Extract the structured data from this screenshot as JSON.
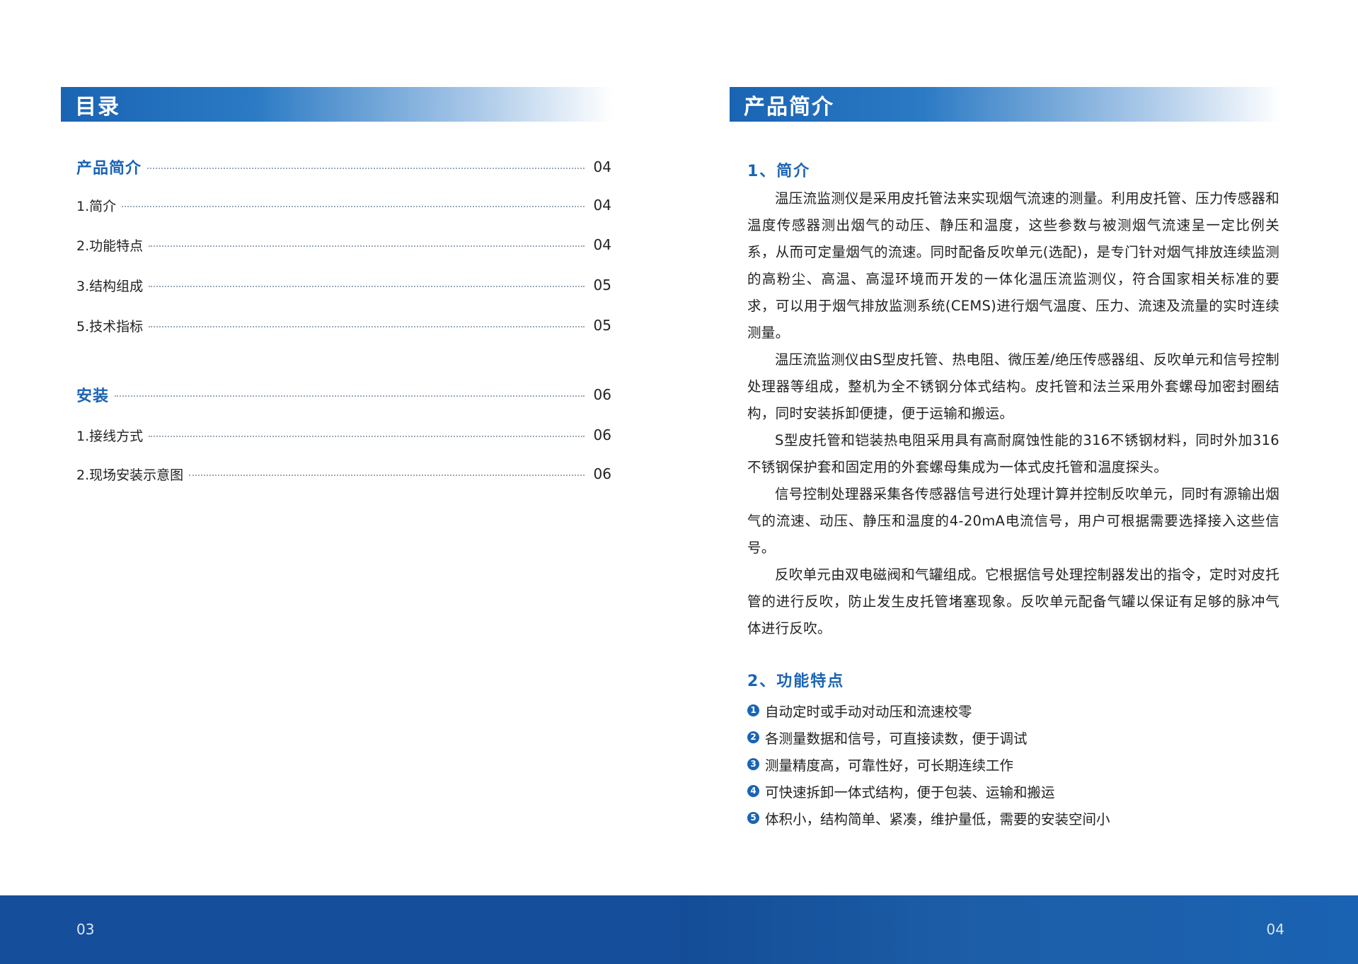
{
  "left": {
    "banner_title": "目录",
    "toc": [
      {
        "label": "产品简介",
        "page": "04",
        "section": true
      },
      {
        "label": "1.简介",
        "page": "04",
        "section": false
      },
      {
        "label": "2.功能特点",
        "page": "04",
        "section": false
      },
      {
        "label": "3.结构组成",
        "page": "05",
        "section": false
      },
      {
        "label": "5.技术指标",
        "page": "05",
        "section": false
      },
      {
        "label": "安装",
        "page": "06",
        "section": true
      },
      {
        "label": "1.接线方式",
        "page": "06",
        "section": false
      },
      {
        "label": "2.现场安装示意图",
        "page": "06",
        "section": false
      }
    ],
    "footer_page": "03"
  },
  "right": {
    "banner_title": "产品简介",
    "intro_heading": "1、简介",
    "paragraphs": [
      "温压流监测仪是采用皮托管法来实现烟气流速的测量。利用皮托管、压力传感器和温度传感器测出烟气的动压、静压和温度，这些参数与被测烟气流速呈一定比例关系，从而可定量烟气的流速。同时配备反吹单元(选配)，是专门针对烟气排放连续监测的高粉尘、高温、高湿环境而开发的一体化温压流监测仪，符合国家相关标准的要求，可以用于烟气排放监测系统(CEMS)进行烟气温度、压力、流速及流量的实时连续测量。",
      "温压流监测仪由S型皮托管、热电阻、微压差/绝压传感器组、反吹单元和信号控制处理器等组成，整机为全不锈钢分体式结构。皮托管和法兰采用外套螺母加密封圈结构，同时安装拆卸便捷，便于运输和搬运。",
      "S型皮托管和铠装热电阻采用具有高耐腐蚀性能的316不锈钢材料，同时外加316不锈钢保护套和固定用的外套螺母集成为一体式皮托管和温度探头。",
      "信号控制处理器采集各传感器信号进行处理计算并控制反吹单元，同时有源输出烟气的流速、动压、静压和温度的4-20mA电流信号，用户可根据需要选择接入这些信号。",
      "反吹单元由双电磁阀和气罐组成。它根据信号处理控制器发出的指令，定时对皮托管的进行反吹，防止发生皮托管堵塞现象。反吹单元配备气罐以保证有足够的脉冲气体进行反吹。"
    ],
    "features_heading": "2、功能特点",
    "features": [
      {
        "num": "1",
        "text": "自动定时或手动对动压和流速校零"
      },
      {
        "num": "2",
        "text": "各测量数据和信号，可直接读数，便于调试"
      },
      {
        "num": "3",
        "text": "测量精度高，可靠性好，可长期连续工作"
      },
      {
        "num": "4",
        "text": "可快速拆卸一体式结构，便于包装、运输和搬运"
      },
      {
        "num": "5",
        "text": "体积小，结构简单、紧凑，维护量低，需要的安装空间小"
      }
    ],
    "footer_page": "04"
  },
  "colors": {
    "accent": "#1a64b4",
    "footer": "#154f9c"
  }
}
